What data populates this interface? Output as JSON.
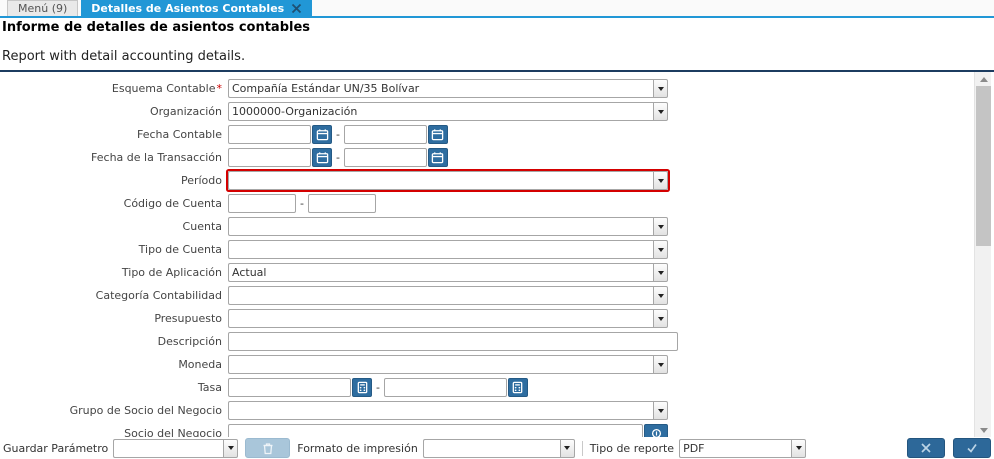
{
  "tabs": {
    "menu_label": "Menú (9)",
    "active_label": "Detalles de Asientos Contables"
  },
  "header": {
    "title": "Informe de detalles de asientos contables",
    "subtitle": "Report with detail accounting details."
  },
  "form": {
    "esquema": {
      "label": "Esquema Contable",
      "required_mark": "*",
      "value": "Compañía Estándar UN/35 Bolívar"
    },
    "organizacion": {
      "label": "Organización",
      "value": "1000000-Organización"
    },
    "fecha_contable": {
      "label": "Fecha Contable",
      "from": "",
      "to": ""
    },
    "fecha_transaccion": {
      "label": "Fecha de la Transacción",
      "from": "",
      "to": ""
    },
    "periodo": {
      "label": "Período",
      "value": ""
    },
    "codigo_cuenta": {
      "label": "Código de Cuenta",
      "from": "",
      "to": ""
    },
    "cuenta": {
      "label": "Cuenta",
      "value": ""
    },
    "tipo_cuenta": {
      "label": "Tipo de Cuenta",
      "value": ""
    },
    "tipo_aplicacion": {
      "label": "Tipo de Aplicación",
      "value": "Actual"
    },
    "categoria": {
      "label": "Categoría Contabilidad",
      "value": ""
    },
    "presupuesto": {
      "label": "Presupuesto",
      "value": ""
    },
    "descripcion": {
      "label": "Descripción",
      "value": ""
    },
    "moneda": {
      "label": "Moneda",
      "value": ""
    },
    "tasa": {
      "label": "Tasa",
      "from": "",
      "to": ""
    },
    "grupo_socio": {
      "label": "Grupo de Socio del Negocio",
      "value": ""
    },
    "socio": {
      "label": "Socio del Negocio",
      "value": ""
    }
  },
  "footer": {
    "save_param_label": "Guardar Parámetro",
    "save_param_value": "",
    "print_format_label": "Formato de impresión",
    "print_format_value": "",
    "report_type_label": "Tipo de reporte",
    "report_type_value": "PDF"
  },
  "icons": {
    "tab_close": "close-x",
    "dropdown": "chevron-down",
    "calendar": "calendar",
    "calculator": "calculator",
    "bpartner_search": "circle-search",
    "delete": "trash",
    "cancel": "x-mark",
    "confirm": "check-mark",
    "scroll_up": "triangle-up",
    "scroll_down": "triangle-down"
  },
  "colors": {
    "accent_tab": "#2197d6",
    "panel_divider": "#1c3c60",
    "field_button": "#2e6da0",
    "confirm_cancel_button": "#2d6899",
    "disabled_button": "#a9c6da",
    "required_red": "#cc0000",
    "error_border": "#d40000"
  }
}
